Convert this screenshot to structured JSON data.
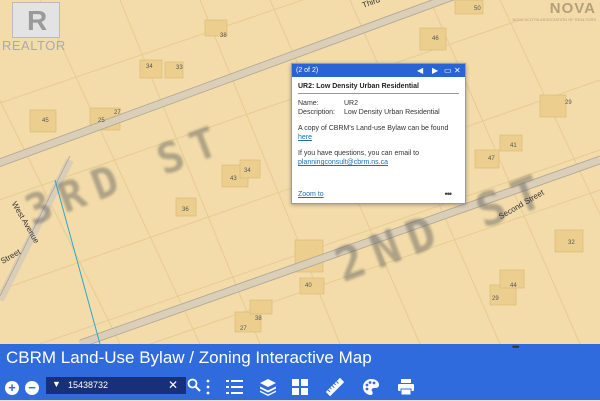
{
  "map": {
    "lots": [
      "38",
      "46",
      "50",
      "34",
      "33",
      "45",
      "25",
      "27",
      "29",
      "47",
      "41",
      "43",
      "34",
      "36",
      "32",
      "44",
      "40",
      "29",
      "38",
      "27",
      "25"
    ],
    "road_labels": [
      "Third",
      "Second Street",
      "West Avenue",
      "Street"
    ],
    "big_labels": [
      "3RD ST",
      "2ND ST"
    ],
    "realtor_logo": "REALTOR",
    "realtor_mark": "R",
    "nova_gov": "NOVA",
    "nova_sub": "NOVA SCOTIA ASSOCIATION OF REALTORS"
  },
  "popup": {
    "count": "(2 of 2)",
    "title": "UR2: Low Density Urban Residential",
    "fields": [
      {
        "key": "Name:",
        "value": "UR2"
      },
      {
        "key": "Description:",
        "value": "Low Density Urban Residential"
      }
    ],
    "para1": "A copy of CBRM's Land-use Bylaw can be found ",
    "para1_link": "here",
    "para2": "If you have questions, you can email to",
    "email": "planningconsult@cbrm.ns.ca",
    "zoom": "Zoom to",
    "more": "•••"
  },
  "bottom": {
    "title": "CBRM Land-Use Bylaw / Zoning Interactive Map",
    "search_value": "15438732",
    "zoom_in": "+",
    "zoom_out": "−"
  },
  "colors": {
    "accent": "#2f6bdc",
    "search_bg": "#17307a",
    "map_bg": "#f3dca9"
  }
}
